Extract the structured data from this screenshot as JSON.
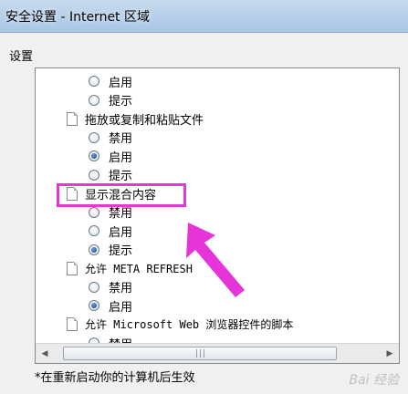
{
  "window": {
    "title": "安全设置 - Internet 区域"
  },
  "group_label": "设置",
  "list_rows": [
    {
      "kind": "option",
      "label": "启用",
      "checked": false
    },
    {
      "kind": "option",
      "label": "提示",
      "checked": false
    },
    {
      "kind": "heading",
      "label": "拖放或复制和粘贴文件"
    },
    {
      "kind": "option",
      "label": "禁用",
      "checked": false
    },
    {
      "kind": "option",
      "label": "启用",
      "checked": true
    },
    {
      "kind": "option",
      "label": "提示",
      "checked": false
    },
    {
      "kind": "heading",
      "label": "显示混合内容"
    },
    {
      "kind": "option",
      "label": "禁用",
      "checked": false
    },
    {
      "kind": "option",
      "label": "启用",
      "checked": false
    },
    {
      "kind": "option",
      "label": "提示",
      "checked": true
    },
    {
      "kind": "heading",
      "label": "允许 META REFRESH"
    },
    {
      "kind": "option",
      "label": "禁用",
      "checked": false
    },
    {
      "kind": "option",
      "label": "启用",
      "checked": true
    },
    {
      "kind": "heading",
      "label": "允许 Microsoft Web 浏览器控件的脚本"
    },
    {
      "kind": "option",
      "label": "禁用",
      "checked": false
    }
  ],
  "scrollbar": {
    "left_arrow": "◀",
    "right_arrow": "▶",
    "grip": "|||"
  },
  "footnote": "*在重新启动你的计算机后生效",
  "watermark": "Bai 经验",
  "annotation_color": "#e634d8"
}
